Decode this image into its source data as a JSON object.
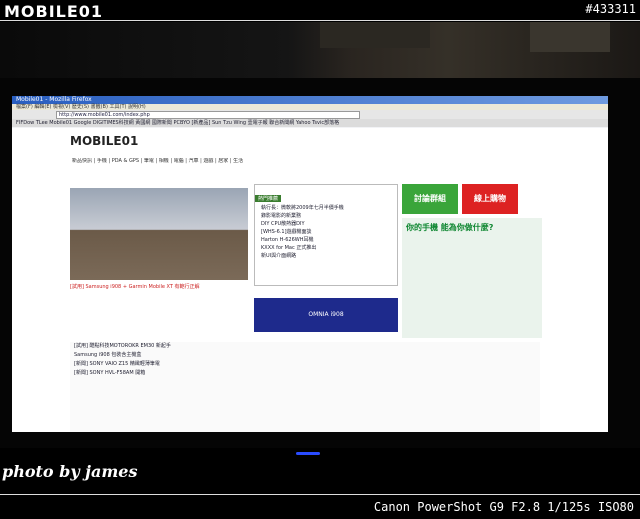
{
  "watermark": {
    "brand": "MOBILE01",
    "photo_id": "#433311"
  },
  "browser": {
    "title": "Mobile01 - Mozilla Firefox",
    "menu": "檔案(F)  編輯(E)  檢視(V)  歷史(S)  書籤(B)  工具(T)  說明(H)",
    "url": "http://www.mobile01.com/index.php",
    "bookmarks": "FIFDow  TLee  Mobile01  Google  DIGITIMES科技網  黃國網  國際新聞  PCBYO  [新產品]  Sun Tzu Wing  壹電子報  聯合新聞網  Yahoo  Tsvic部落格"
  },
  "site": {
    "logo": "MOBILE01",
    "nav": "新品快訊 | 手機 | PDA & GPS | 筆電 | 相機 | 電腦 | 汽車 | 遊戲 | 居家 | 生活",
    "hero_caption": "[試用] Samsung i908 + Garmin Mobile XT 有範行正解",
    "tab_label": "熱門推薦",
    "news": [
      "執行長：微軟將2009年七月半價手機",
      "錄影電影的新業務",
      "DIY CPU散熱器DIY",
      "[WHS-6.1]遊戲機面談",
      "Harton H-626WH耳機",
      "KXXX for Mac 正式推出",
      "新UI與介面網路"
    ],
    "ad_green": "討論群組",
    "ad_red": "線上購物",
    "ad_nokia": "你的手機 能為你做什麼?",
    "ad_omnia": "OMNIA i908",
    "lower_rows": [
      "[試用] 酷點科技MOTOROKR EM30 新起手",
      "Samsung i908 包裝含主機盒",
      "[新聞] SONY VAIO Z15 精緻輕薄筆電",
      "[新聞] SONY HVL-F58AM 開箱"
    ]
  },
  "caption": {
    "photographer": "photo by james",
    "exif": "Canon PowerShot G9 F2.8 1/125s ISO80"
  }
}
